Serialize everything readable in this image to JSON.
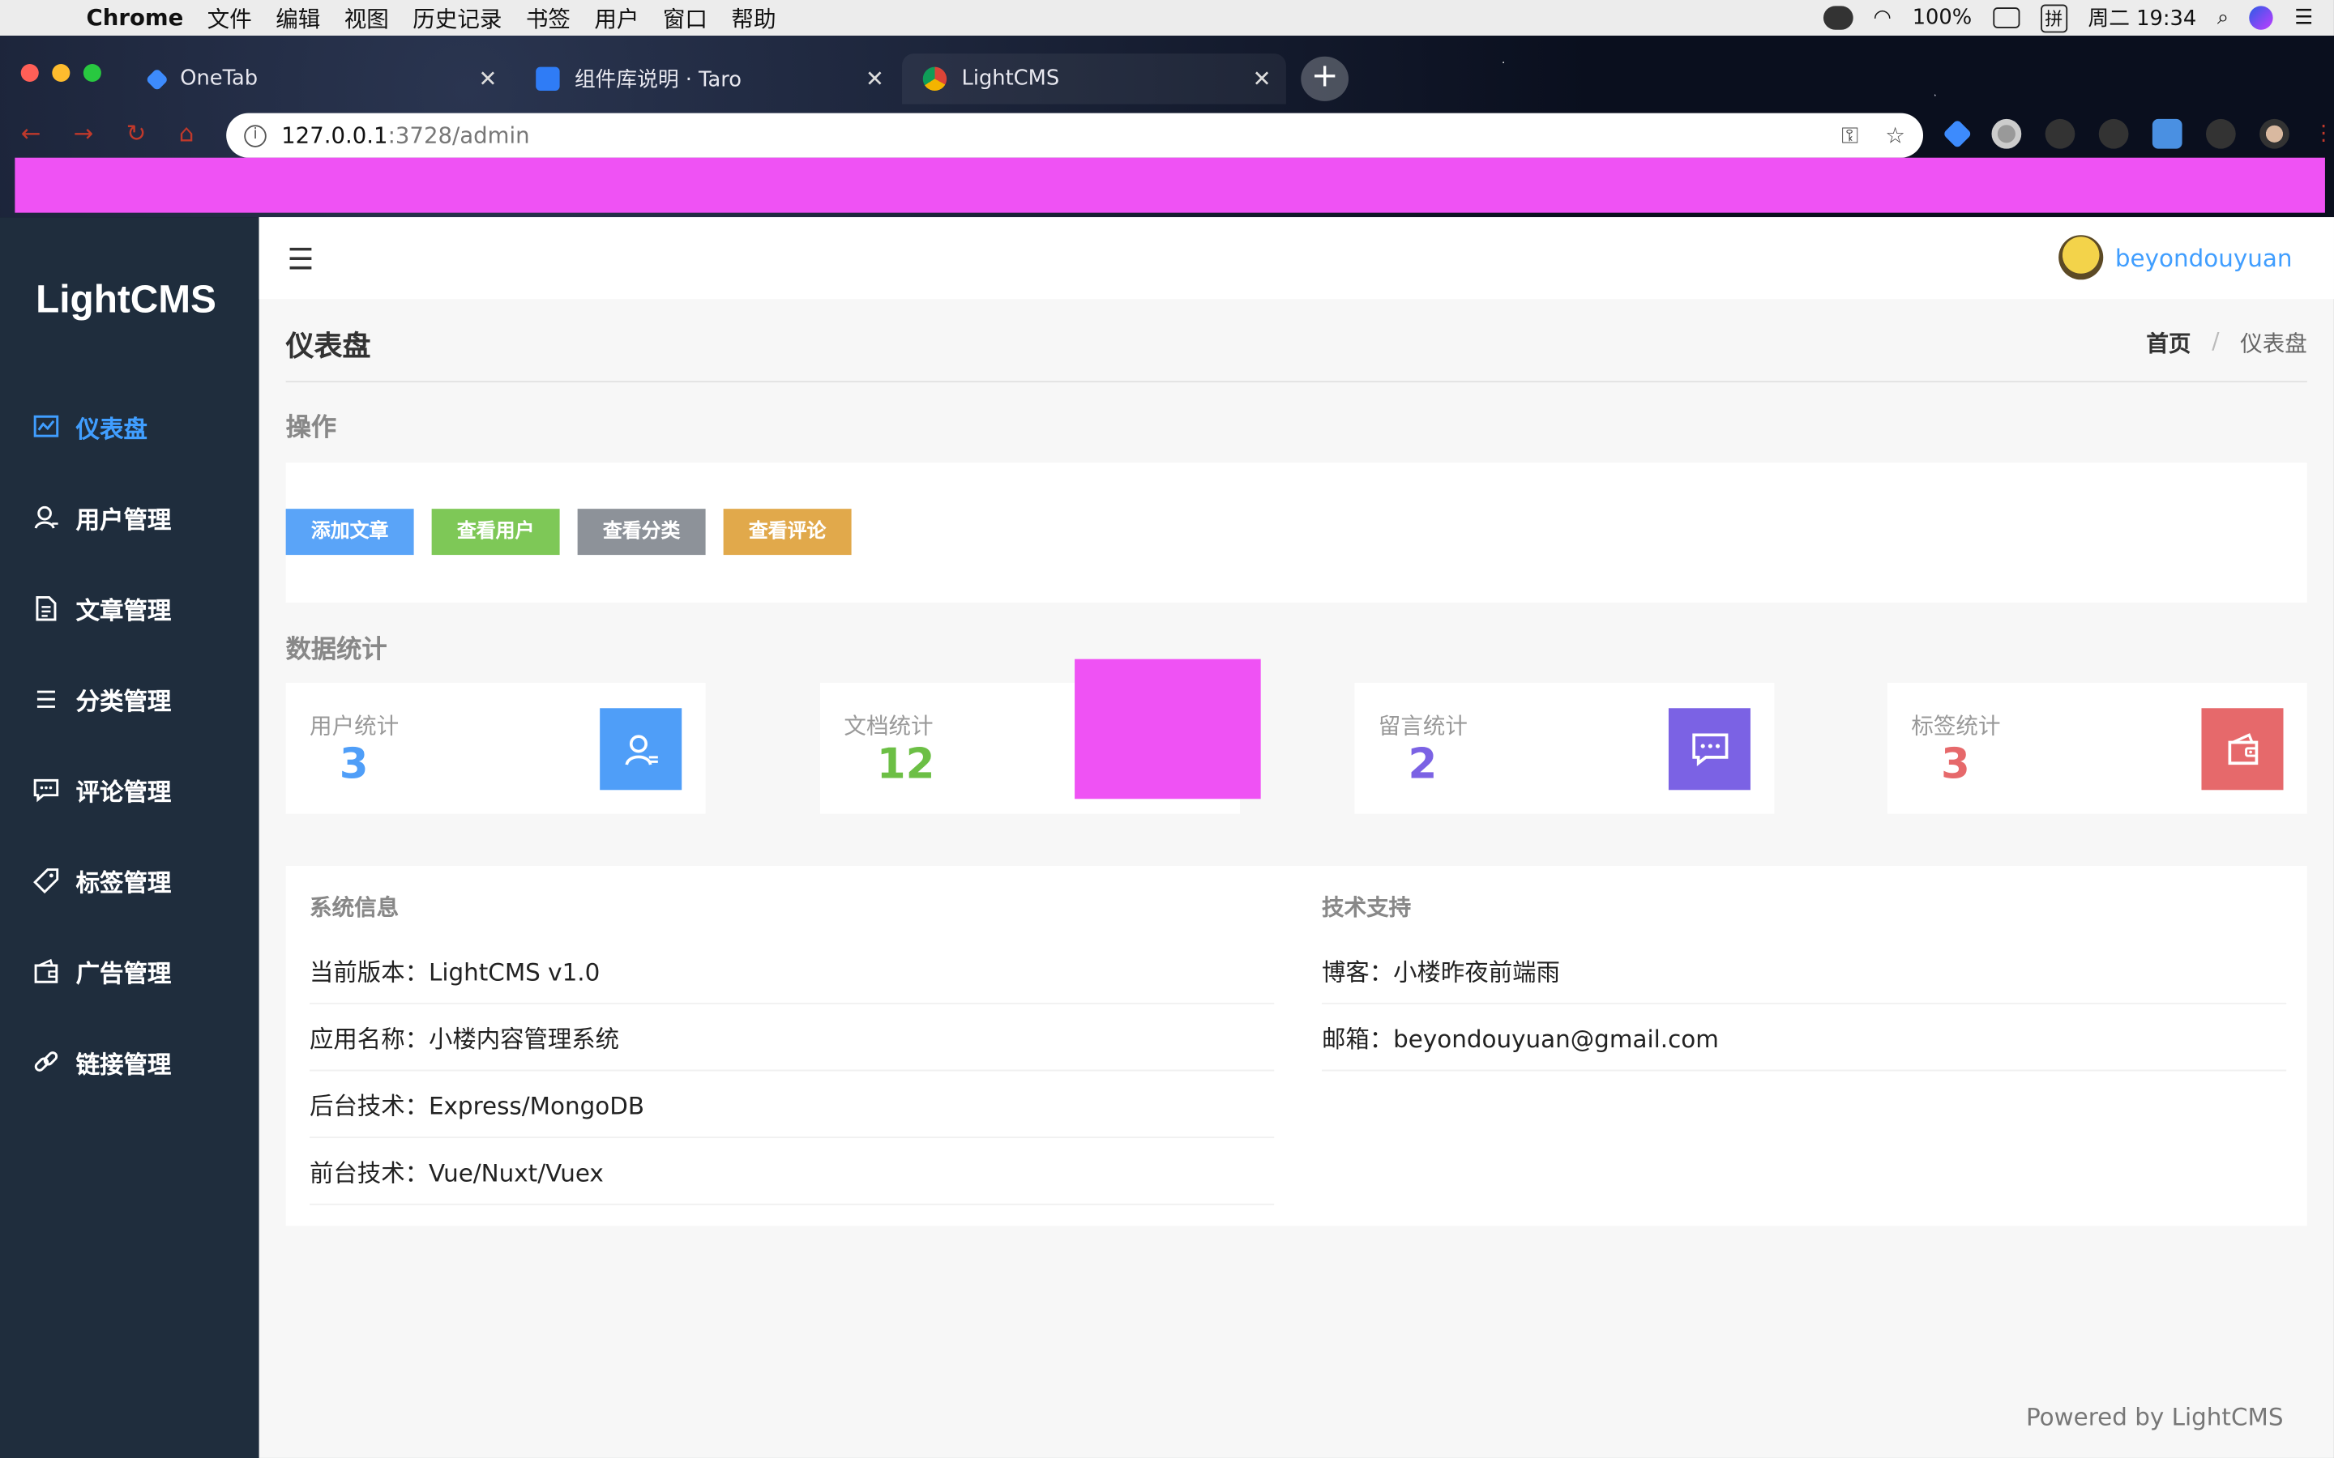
{
  "menubar": {
    "app": "Chrome",
    "items": [
      "文件",
      "编辑",
      "视图",
      "历史记录",
      "书签",
      "用户",
      "窗口",
      "帮助"
    ],
    "battery": "100%",
    "ime": "拼",
    "clock": "周二 19:34"
  },
  "browser": {
    "tabs": [
      {
        "title": "OneTab"
      },
      {
        "title": "组件库说明 · Taro"
      },
      {
        "title": "LightCMS"
      }
    ],
    "url_host": "127.0.0.1",
    "url_path": ":3728/admin"
  },
  "sidebar": {
    "logo": "LightCMS",
    "items": [
      {
        "label": "仪表盘",
        "icon": "dashboard-icon"
      },
      {
        "label": "用户管理",
        "icon": "user-icon"
      },
      {
        "label": "文章管理",
        "icon": "document-icon"
      },
      {
        "label": "分类管理",
        "icon": "list-icon"
      },
      {
        "label": "评论管理",
        "icon": "comment-icon"
      },
      {
        "label": "标签管理",
        "icon": "tag-icon"
      },
      {
        "label": "广告管理",
        "icon": "ad-icon"
      },
      {
        "label": "链接管理",
        "icon": "link-icon"
      }
    ]
  },
  "header": {
    "username": "beyondouyuan"
  },
  "page": {
    "title": "仪表盘",
    "breadcrumb": {
      "home": "首页",
      "sep": "/",
      "current": "仪表盘"
    }
  },
  "operations": {
    "label": "操作",
    "buttons": [
      {
        "label": "添加文章",
        "color": "#5aa4f8"
      },
      {
        "label": "查看用户",
        "color": "#7ec857"
      },
      {
        "label": "查看分类",
        "color": "#8d9299"
      },
      {
        "label": "查看评论",
        "color": "#e1a94b"
      }
    ]
  },
  "stats": {
    "label": "数据统计",
    "cards": [
      {
        "label": "用户统计",
        "value": "3",
        "color": "#4f9ef8",
        "icon": "user-icon"
      },
      {
        "label": "文档统计",
        "value": "12",
        "color": "#6cbf45",
        "icon": "document-icon"
      },
      {
        "label": "留言统计",
        "value": "2",
        "color": "#7b62e4",
        "icon": "comment-icon"
      },
      {
        "label": "标签统计",
        "value": "3",
        "color": "#e6696b",
        "icon": "wallet-icon"
      }
    ]
  },
  "system": {
    "title": "系统信息",
    "rows": [
      "当前版本：LightCMS v1.0",
      "应用名称：小楼内容管理系统",
      "后台技术：Express/MongoDB",
      "前台技术：Vue/Nuxt/Vuex"
    ]
  },
  "support": {
    "title": "技术支持",
    "rows": [
      "博客：小楼昨夜前端雨",
      "邮箱：beyondouyuan@gmail.com"
    ]
  },
  "footer": {
    "powered": "Powered by LightCMS"
  }
}
